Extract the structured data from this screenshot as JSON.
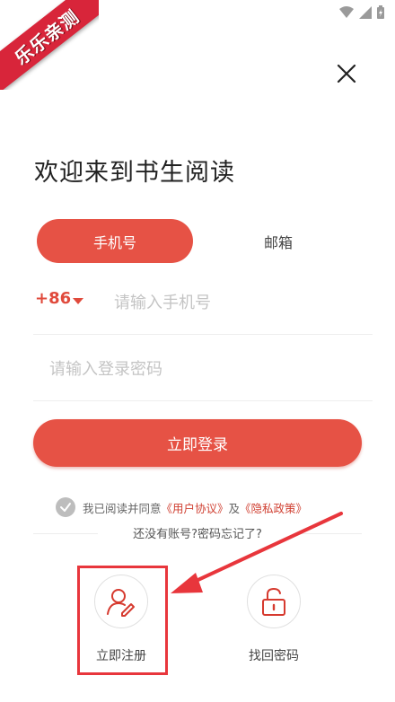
{
  "watermark": {
    "text": "乐乐亲测"
  },
  "status_bar": {
    "icons": [
      "wifi-icon",
      "signal-icon",
      "battery-icon"
    ]
  },
  "header": {
    "close_icon": "close-icon"
  },
  "title": "欢迎来到书生阅读",
  "tabs": [
    {
      "label": "手机号",
      "active": true
    },
    {
      "label": "邮箱",
      "active": false
    }
  ],
  "phone": {
    "country_code": "+86",
    "placeholder": "请输入手机号",
    "value": ""
  },
  "password": {
    "placeholder": "请输入登录密码",
    "value": ""
  },
  "login_button": {
    "label": "立即登录"
  },
  "agreement": {
    "checked": true,
    "prefix": "我已阅读并同意",
    "user_agreement": "《用户协议》",
    "conjunction": "及",
    "privacy_policy": "《隐私政策》"
  },
  "help_text": "还没有账号?密码忘记了?",
  "actions": [
    {
      "label": "立即注册",
      "icon": "user-edit-icon"
    },
    {
      "label": "找回密码",
      "icon": "unlock-icon"
    }
  ],
  "colors": {
    "accent": "#e65245",
    "annotation": "#e8363c"
  }
}
